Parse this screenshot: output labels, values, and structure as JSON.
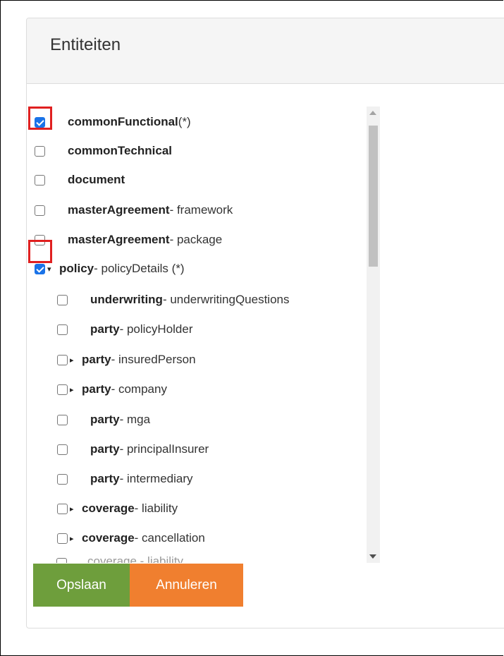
{
  "panel": {
    "title": "Entiteiten"
  },
  "entities": [
    {
      "name": "commonFunctional",
      "suffix": " (*)",
      "checked": true,
      "highlighted": true,
      "arrow": ""
    },
    {
      "name": "commonTechnical",
      "suffix": "",
      "checked": false,
      "highlighted": false,
      "arrow": ""
    },
    {
      "name": "document",
      "suffix": "",
      "checked": false,
      "highlighted": false,
      "arrow": ""
    },
    {
      "name": "masterAgreement",
      "suffix": " - framework",
      "checked": false,
      "highlighted": false,
      "arrow": ""
    },
    {
      "name": "masterAgreement",
      "suffix": " - package",
      "checked": false,
      "highlighted": false,
      "arrow": ""
    },
    {
      "name": "policy",
      "suffix": " - policyDetails (*)",
      "checked": true,
      "highlighted": true,
      "arrow": "▾",
      "children": [
        {
          "name": "underwriting",
          "suffix": " - underwritingQuestions",
          "checked": false,
          "arrow": ""
        },
        {
          "name": "party",
          "suffix": " - policyHolder",
          "checked": false,
          "arrow": ""
        },
        {
          "name": "party",
          "suffix": " - insuredPerson",
          "checked": false,
          "arrow": "▸"
        },
        {
          "name": "party",
          "suffix": " - company",
          "checked": false,
          "arrow": "▸"
        },
        {
          "name": "party",
          "suffix": " - mga",
          "checked": false,
          "arrow": ""
        },
        {
          "name": "party",
          "suffix": " - principalInsurer",
          "checked": false,
          "arrow": ""
        },
        {
          "name": "party",
          "suffix": " - intermediary",
          "checked": false,
          "arrow": ""
        },
        {
          "name": "coverage",
          "suffix": " - liability",
          "checked": false,
          "arrow": "▸"
        },
        {
          "name": "coverage",
          "suffix": " - cancellation",
          "checked": false,
          "arrow": "▸"
        }
      ]
    }
  ],
  "partial_row": {
    "text": "coverage - liability"
  },
  "buttons": {
    "save": "Opslaan",
    "cancel": "Annuleren"
  },
  "colors": {
    "save": "#6e9e3c",
    "cancel": "#f07f2f",
    "highlight": "#e02020",
    "checkbox": "#1a73e8"
  }
}
